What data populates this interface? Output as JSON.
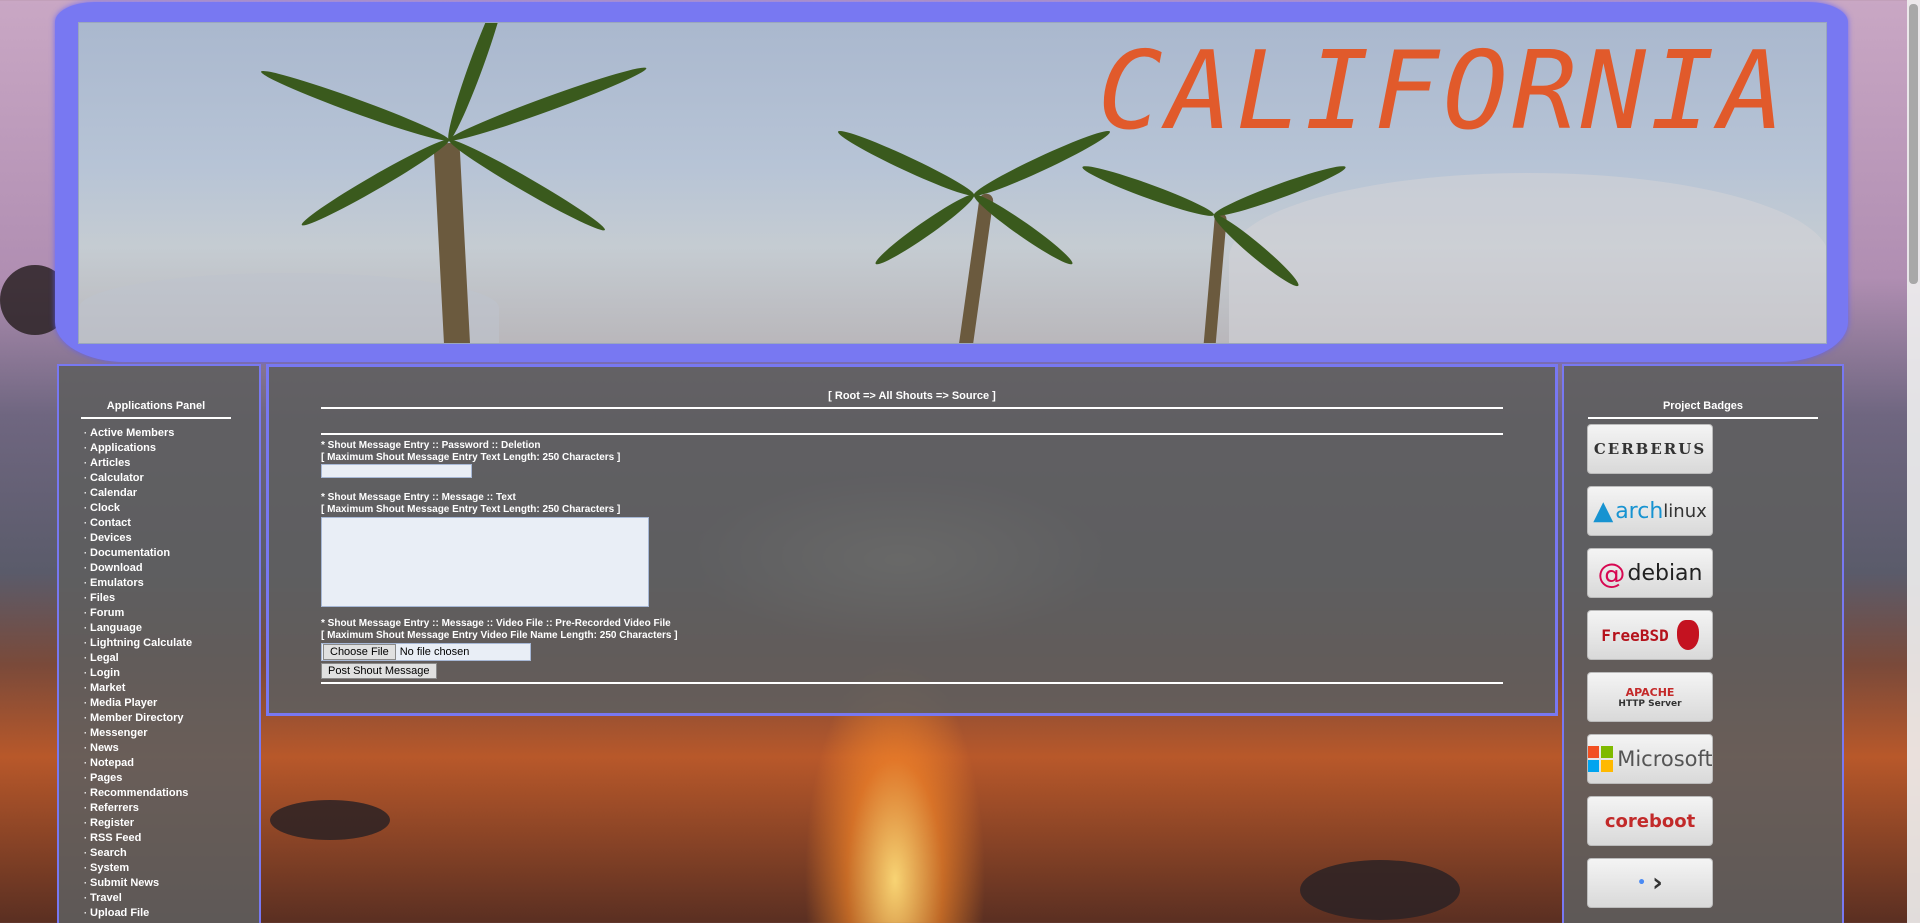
{
  "banner": {
    "title": "CALIFORNIA"
  },
  "left_panel": {
    "title": "Applications Panel",
    "items": [
      "Active Members",
      "Applications",
      "Articles",
      "Calculator",
      "Calendar",
      "Clock",
      "Contact",
      "Devices",
      "Documentation",
      "Download",
      "Emulators",
      "Files",
      "Forum",
      "Language",
      "Lightning Calculate",
      "Legal",
      "Login",
      "Market",
      "Media Player",
      "Member Directory",
      "Messenger",
      "News",
      "Notepad",
      "Pages",
      "Recommendations",
      "Referrers",
      "Register",
      "RSS Feed",
      "Search",
      "System",
      "Submit News",
      "Travel",
      "Upload File"
    ]
  },
  "main": {
    "breadcrumb": "[ Root => All Shouts => Source ]",
    "password_label": "* Shout Message Entry :: Password :: Deletion",
    "password_hint": "[ Maximum Shout Message Entry Text Length: 250 Characters ]",
    "message_label": "* Shout Message Entry :: Message :: Text",
    "message_hint": "[ Maximum Shout Message Entry Text Length: 250 Characters ]",
    "video_label": "* Shout Message Entry :: Message :: Video File :: Pre-Recorded Video File",
    "video_hint": "[ Maximum Shout Message Entry Video File Name Length: 250 Characters ]",
    "choose_file": "Choose File",
    "no_file": "No file chosen",
    "post_button": "Post Shout Message"
  },
  "right_panel": {
    "title": "Project Badges",
    "badges": [
      "cerberus",
      "archlinux",
      "debian",
      "FreeBSD",
      "Apache HTTP Server",
      "Microsoft",
      "coreboot",
      "dev"
    ],
    "badge_text": {
      "cerberus": "CERBERUS",
      "arch_1": "arch",
      "arch_2": "linux",
      "debian": "debian",
      "freebsd": "FreeBSD",
      "apache_1": "APACHE",
      "apache_2": "HTTP Server",
      "microsoft": "Microsoft",
      "coreboot": "coreboot"
    }
  },
  "colors": {
    "frame": "#7878f2",
    "title": "#e15a2b",
    "panel": "#5f5f5f"
  }
}
